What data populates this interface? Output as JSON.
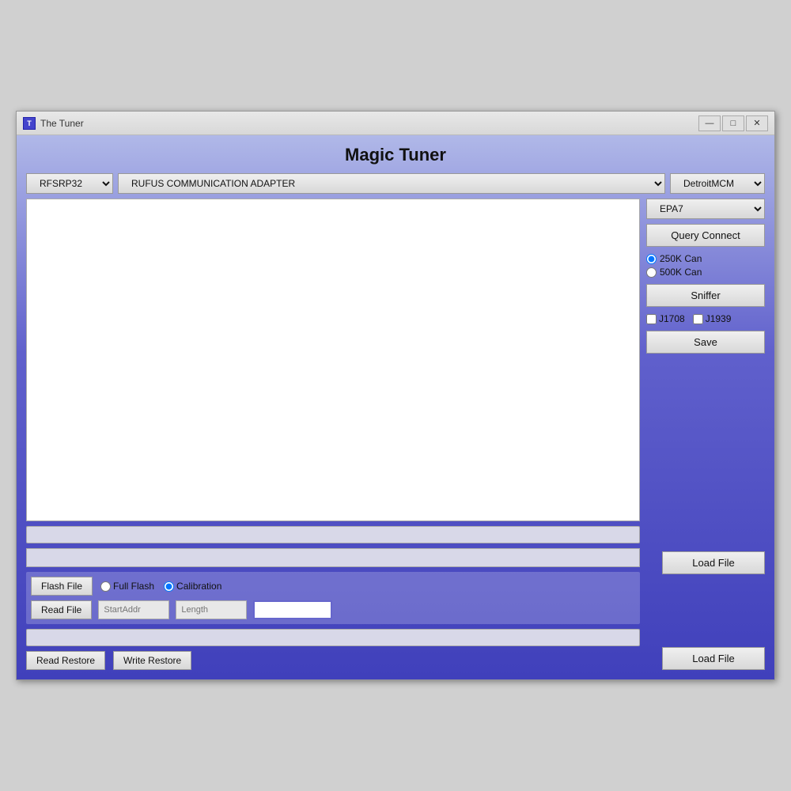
{
  "window": {
    "title": "The Tuner",
    "icon_label": "T"
  },
  "header": {
    "title": "Magic Tuner"
  },
  "controls": {
    "ecu_dropdown": {
      "value": "RFSRP32",
      "options": [
        "RFSRP32"
      ]
    },
    "adapter_dropdown": {
      "value": "RUFUS COMMUNICATION ADAPTER",
      "options": [
        "RUFUS COMMUNICATION ADAPTER"
      ]
    },
    "ecu_type_dropdown": {
      "value": "DetroitMCM",
      "options": [
        "DetroitMCM"
      ]
    },
    "epa_dropdown": {
      "value": "EPA7",
      "options": [
        "EPA7"
      ]
    }
  },
  "buttons": {
    "query_connect": "Query Connect",
    "sniffer": "Sniffer",
    "save": "Save",
    "load_file_top": "Load File",
    "load_file_bottom": "Load File",
    "flash_file": "Flash File",
    "read_file": "Read File",
    "read_restore": "Read Restore",
    "write_restore": "Write Restore"
  },
  "radio_options": {
    "can_250": "250K Can",
    "can_500": "500K Can",
    "full_flash": "Full Flash",
    "calibration": "Calibration"
  },
  "checkboxes": {
    "j1708": "J1708",
    "j1939": "J1939"
  },
  "inputs": {
    "start_addr": {
      "placeholder": "StartAddr",
      "value": ""
    },
    "length": {
      "placeholder": "Length",
      "value": ""
    }
  },
  "title_bar_buttons": {
    "minimize": "—",
    "maximize": "□",
    "close": "✕"
  }
}
